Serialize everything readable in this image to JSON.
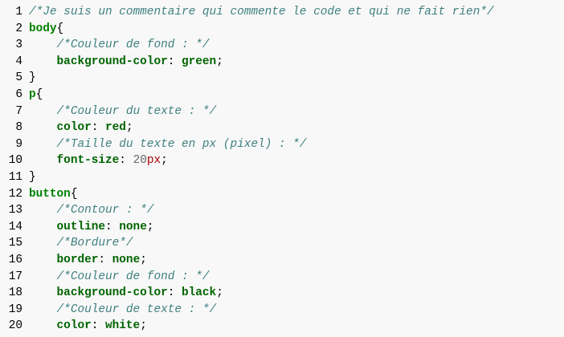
{
  "editor": {
    "lines": [
      {
        "number": "1",
        "tokens": [
          {
            "type": "comment",
            "text": "/*Je suis un commentaire qui commente le code et qui ne fait rien*/"
          }
        ]
      },
      {
        "number": "2",
        "tokens": [
          {
            "type": "selector",
            "text": "body"
          },
          {
            "type": "punct",
            "text": "{"
          }
        ]
      },
      {
        "number": "3",
        "tokens": [
          {
            "type": "text",
            "text": "    "
          },
          {
            "type": "comment",
            "text": "/*Couleur de fond : */"
          }
        ]
      },
      {
        "number": "4",
        "tokens": [
          {
            "type": "text",
            "text": "    "
          },
          {
            "type": "property",
            "text": "background-color"
          },
          {
            "type": "punct",
            "text": ": "
          },
          {
            "type": "value",
            "text": "green"
          },
          {
            "type": "punct",
            "text": ";"
          }
        ]
      },
      {
        "number": "5",
        "tokens": [
          {
            "type": "punct",
            "text": "}"
          }
        ]
      },
      {
        "number": "6",
        "tokens": [
          {
            "type": "selector",
            "text": "p"
          },
          {
            "type": "punct",
            "text": "{"
          }
        ]
      },
      {
        "number": "7",
        "tokens": [
          {
            "type": "text",
            "text": "    "
          },
          {
            "type": "comment",
            "text": "/*Couleur du texte : */"
          }
        ]
      },
      {
        "number": "8",
        "tokens": [
          {
            "type": "text",
            "text": "    "
          },
          {
            "type": "property",
            "text": "color"
          },
          {
            "type": "punct",
            "text": ": "
          },
          {
            "type": "value",
            "text": "red"
          },
          {
            "type": "punct",
            "text": ";"
          }
        ]
      },
      {
        "number": "9",
        "tokens": [
          {
            "type": "text",
            "text": "    "
          },
          {
            "type": "comment",
            "text": "/*Taille du texte en px (pixel) : */"
          }
        ]
      },
      {
        "number": "10",
        "tokens": [
          {
            "type": "text",
            "text": "    "
          },
          {
            "type": "property",
            "text": "font-size"
          },
          {
            "type": "punct",
            "text": ": "
          },
          {
            "type": "number",
            "text": "20"
          },
          {
            "type": "unit",
            "text": "px"
          },
          {
            "type": "punct",
            "text": ";"
          }
        ]
      },
      {
        "number": "11",
        "tokens": [
          {
            "type": "punct",
            "text": "}"
          }
        ]
      },
      {
        "number": "12",
        "tokens": [
          {
            "type": "selector",
            "text": "button"
          },
          {
            "type": "punct",
            "text": "{"
          }
        ]
      },
      {
        "number": "13",
        "tokens": [
          {
            "type": "text",
            "text": "    "
          },
          {
            "type": "comment",
            "text": "/*Contour : */"
          }
        ]
      },
      {
        "number": "14",
        "tokens": [
          {
            "type": "text",
            "text": "    "
          },
          {
            "type": "property",
            "text": "outline"
          },
          {
            "type": "punct",
            "text": ": "
          },
          {
            "type": "value",
            "text": "none"
          },
          {
            "type": "punct",
            "text": ";"
          }
        ]
      },
      {
        "number": "15",
        "tokens": [
          {
            "type": "text",
            "text": "    "
          },
          {
            "type": "comment",
            "text": "/*Bordure*/"
          }
        ]
      },
      {
        "number": "16",
        "tokens": [
          {
            "type": "text",
            "text": "    "
          },
          {
            "type": "property",
            "text": "border"
          },
          {
            "type": "punct",
            "text": ": "
          },
          {
            "type": "value",
            "text": "none"
          },
          {
            "type": "punct",
            "text": ";"
          }
        ]
      },
      {
        "number": "17",
        "tokens": [
          {
            "type": "text",
            "text": "    "
          },
          {
            "type": "comment",
            "text": "/*Couleur de fond : */"
          }
        ]
      },
      {
        "number": "18",
        "tokens": [
          {
            "type": "text",
            "text": "    "
          },
          {
            "type": "property",
            "text": "background-color"
          },
          {
            "type": "punct",
            "text": ": "
          },
          {
            "type": "value",
            "text": "black"
          },
          {
            "type": "punct",
            "text": ";"
          }
        ]
      },
      {
        "number": "19",
        "tokens": [
          {
            "type": "text",
            "text": "    "
          },
          {
            "type": "comment",
            "text": "/*Couleur de texte : */"
          }
        ]
      },
      {
        "number": "20",
        "tokens": [
          {
            "type": "text",
            "text": "    "
          },
          {
            "type": "property",
            "text": "color"
          },
          {
            "type": "punct",
            "text": ": "
          },
          {
            "type": "value",
            "text": "white"
          },
          {
            "type": "punct",
            "text": ";"
          }
        ]
      }
    ]
  },
  "colors": {
    "background": "#f8f8f8",
    "comment": "#408080",
    "selector": "#008000",
    "property": "#006400",
    "number": "#666666",
    "unit": "#aa0000"
  }
}
